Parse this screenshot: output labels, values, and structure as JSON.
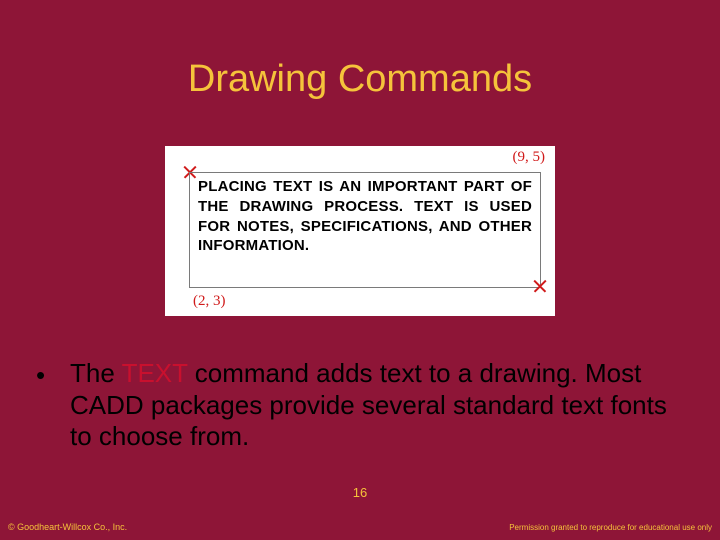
{
  "title": "Drawing Commands",
  "illustration": {
    "coord_top_right": "(9, 5)",
    "coord_bottom_left": "(2, 3)",
    "body_text": "PLACING TEXT IS AN IMPORTANT PART OF THE DRAWING PROCESS. TEXT IS USED FOR NOTES, SPECIFICATIONS, AND OTHER INFORMATION."
  },
  "bullet": {
    "pre": "The ",
    "keyword": "TEXT",
    "post": " command adds text to a drawing. Most CADD packages provide several standard text fonts to choose from."
  },
  "page_number": "16",
  "footer_left": "© Goodheart-Willcox Co., Inc.",
  "footer_right": "Permission granted to reproduce for educational use only"
}
